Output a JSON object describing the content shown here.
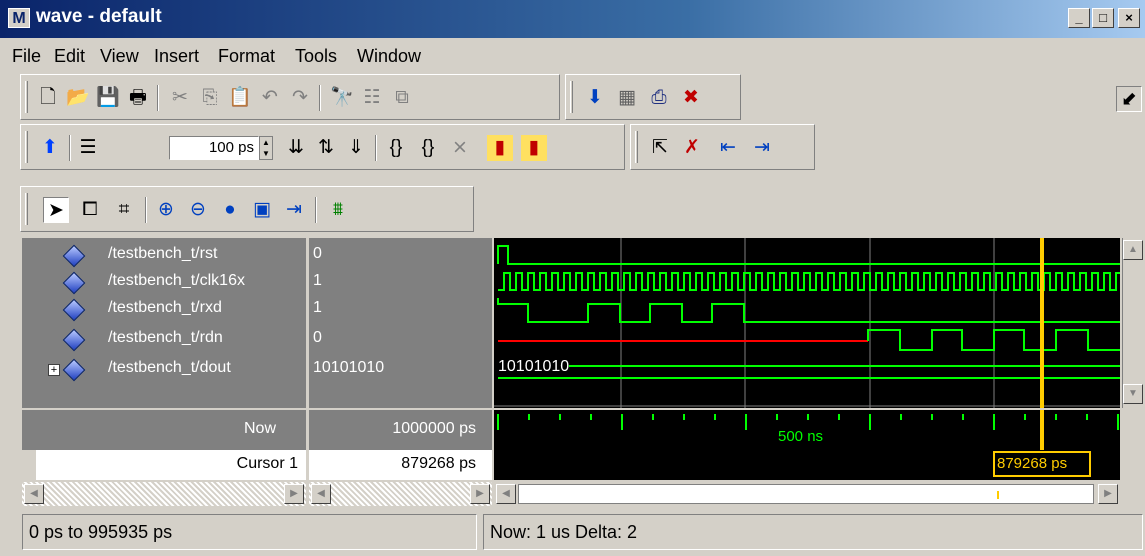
{
  "window": {
    "title": "wave - default",
    "app_icon_letter": "M",
    "minimize_glyph": "_",
    "maximize_glyph": "□",
    "close_glyph": "×"
  },
  "menu": [
    "File",
    "Edit",
    "View",
    "Insert",
    "Format",
    "Tools",
    "Window"
  ],
  "toolbar": {
    "step_value": "100 ps"
  },
  "signals": [
    {
      "name": "/testbench_t/rst",
      "value": "0"
    },
    {
      "name": "/testbench_t/clk16x",
      "value": "1"
    },
    {
      "name": "/testbench_t/rxd",
      "value": "1"
    },
    {
      "name": "/testbench_t/rdn",
      "value": "0"
    },
    {
      "name": "/testbench_t/dout",
      "value": "10101010",
      "expandable": true,
      "bus_label": "10101010"
    }
  ],
  "timing": {
    "now_label": "Now",
    "now_value": "1000000 ps",
    "cursor_label": "Cursor 1",
    "cursor_value": "879268 ps",
    "tick_label_500ns": "500 ns",
    "cursor_flag": "879268 ps",
    "cursor_time_ps": 879268,
    "range_end_ps": 995935
  },
  "status": {
    "range": "0 ps to 995935 ps",
    "now_delta": "Now: 1 us   Delta: 2"
  },
  "colors": {
    "wave": "#00ff00",
    "undefined_wave": "#ff0000",
    "cursor": "#ffcc00",
    "grid": "#808080"
  }
}
